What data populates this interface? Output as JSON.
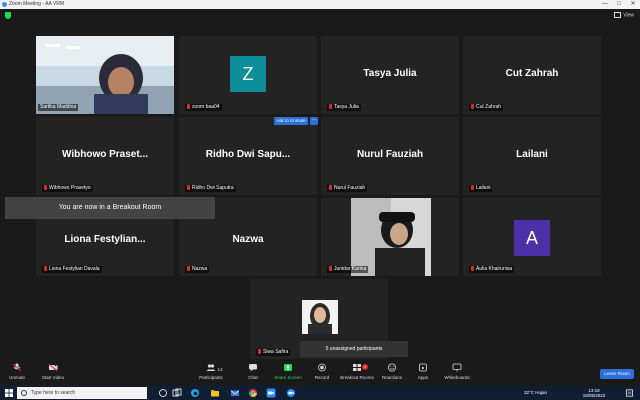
{
  "window": {
    "title": "Zoom Meeting - AA VRM",
    "view_label": "View",
    "minimize": "—",
    "maximize": "□",
    "close": "✕"
  },
  "tiles": [
    {
      "id": "t1",
      "type": "video",
      "label": "Sartika Maddina",
      "speaking": true
    },
    {
      "id": "t2",
      "type": "avatar",
      "letter": "Z",
      "color": "#0e8e9a",
      "label": "zoom baa04"
    },
    {
      "id": "t3",
      "type": "name",
      "name": "Tasya Julia",
      "label": "Tasya Julia"
    },
    {
      "id": "t4",
      "type": "name",
      "name": "Cut Zahrah",
      "label": "Cut Zahrah"
    },
    {
      "id": "t5",
      "type": "name",
      "name": "Wibhowo Praset...",
      "label": "Wibhowo Prasetyo"
    },
    {
      "id": "t6",
      "type": "name",
      "name": "Ridho Dwi Sapu...",
      "label": "Ridho Dwi Saputra"
    },
    {
      "id": "t7",
      "type": "name",
      "name": "Nurul Fauziah",
      "label": "Nurul Fauziah"
    },
    {
      "id": "t8",
      "type": "name",
      "name": "Lailani",
      "label": "Lailani"
    },
    {
      "id": "t9",
      "type": "name",
      "name": "Liona Festylian...",
      "label": "Liona Festylian Davala"
    },
    {
      "id": "t10",
      "type": "name",
      "name": "Nazwa",
      "label": "Nazwa"
    },
    {
      "id": "t11",
      "type": "photo",
      "label": "Junidar Karina"
    },
    {
      "id": "t12",
      "type": "avatar",
      "letter": "A",
      "color": "#4b30a8",
      "label": "Aulia Khairunisa"
    },
    {
      "id": "t13",
      "type": "photo2",
      "label": "Siwa Safira"
    }
  ],
  "ask_unmute": "Ask to Unmute",
  "ask_more": "···",
  "breakout_banner": "You are now in a Breakout Room",
  "unassigned": "5 unassigned participants",
  "toolbar": {
    "unmute": "Unmute",
    "start_video": "Start Video",
    "participants": "Participants",
    "participants_count": "13",
    "chat": "Chat",
    "share_screen": "Share Screen",
    "record": "Record",
    "breakout_rooms": "Breakout Rooms",
    "breakout_badge": "1",
    "reactions": "Reactions",
    "apps": "Apps",
    "whiteboards": "Whiteboards",
    "leave_room": "Leave Room"
  },
  "taskbar": {
    "search_placeholder": "Type here to search",
    "weather": "32°C  Hujan",
    "time": "13:18",
    "date": "19/05/2022"
  },
  "colors": {
    "accent": "#2d6fd8",
    "speaking": "#e2e24a",
    "muted": "#e02828",
    "share": "#23d959"
  }
}
